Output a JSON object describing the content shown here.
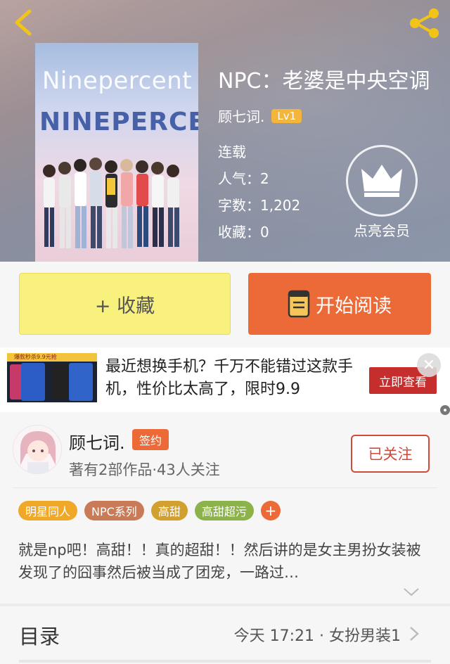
{
  "header": {
    "back_icon": "back-arrow-icon",
    "share_icon": "share-icon"
  },
  "book": {
    "cover": {
      "title_light": "Ninepercent",
      "title_bold": "NINEPERCENT"
    },
    "title": "NPC：老婆是中央空调",
    "author": "顾七词.",
    "level": "Lv1",
    "status": "连载",
    "popularity": "人气：2",
    "word_count": "字数：1,202",
    "favorites": "收藏：0"
  },
  "vip": {
    "icon": "crown-icon",
    "label": "点亮会员"
  },
  "actions": {
    "favorite_label": "+ 收藏",
    "read_label": "开始阅读",
    "read_icon": "book-icon"
  },
  "ad": {
    "thumb_banner": "爆款秒杀9.9元抢",
    "text": "最近想换手机？千万不能错过这款手机，性价比太高了，限时9.9",
    "button": "立即查看",
    "close": "✕"
  },
  "author_card": {
    "name": "顾七词.",
    "badge": "签约",
    "meta": "著有2部作品·43人关注",
    "follow_label": "已关注"
  },
  "tags": [
    {
      "label": "明星同人",
      "color": "#f0a829"
    },
    {
      "label": "NPC系列",
      "color": "#c97a56"
    },
    {
      "label": "高甜",
      "color": "#d1a02f"
    },
    {
      "label": "高甜超污",
      "color": "#8bb34a"
    }
  ],
  "tag_more": "+",
  "description": "就是np吧！高甜！！真的超甜！！然后讲的是女主男扮女装被发现了的囧事然后被当成了团宠，一路过…",
  "toc": {
    "title": "目录",
    "latest": "今天 17:21 · 女扮男装1"
  },
  "colors": {
    "accent_orange": "#ec6a37",
    "favorite_yellow": "#f9f17d",
    "follow_red": "#d04a3a",
    "level_gold": "#f4b63a"
  }
}
